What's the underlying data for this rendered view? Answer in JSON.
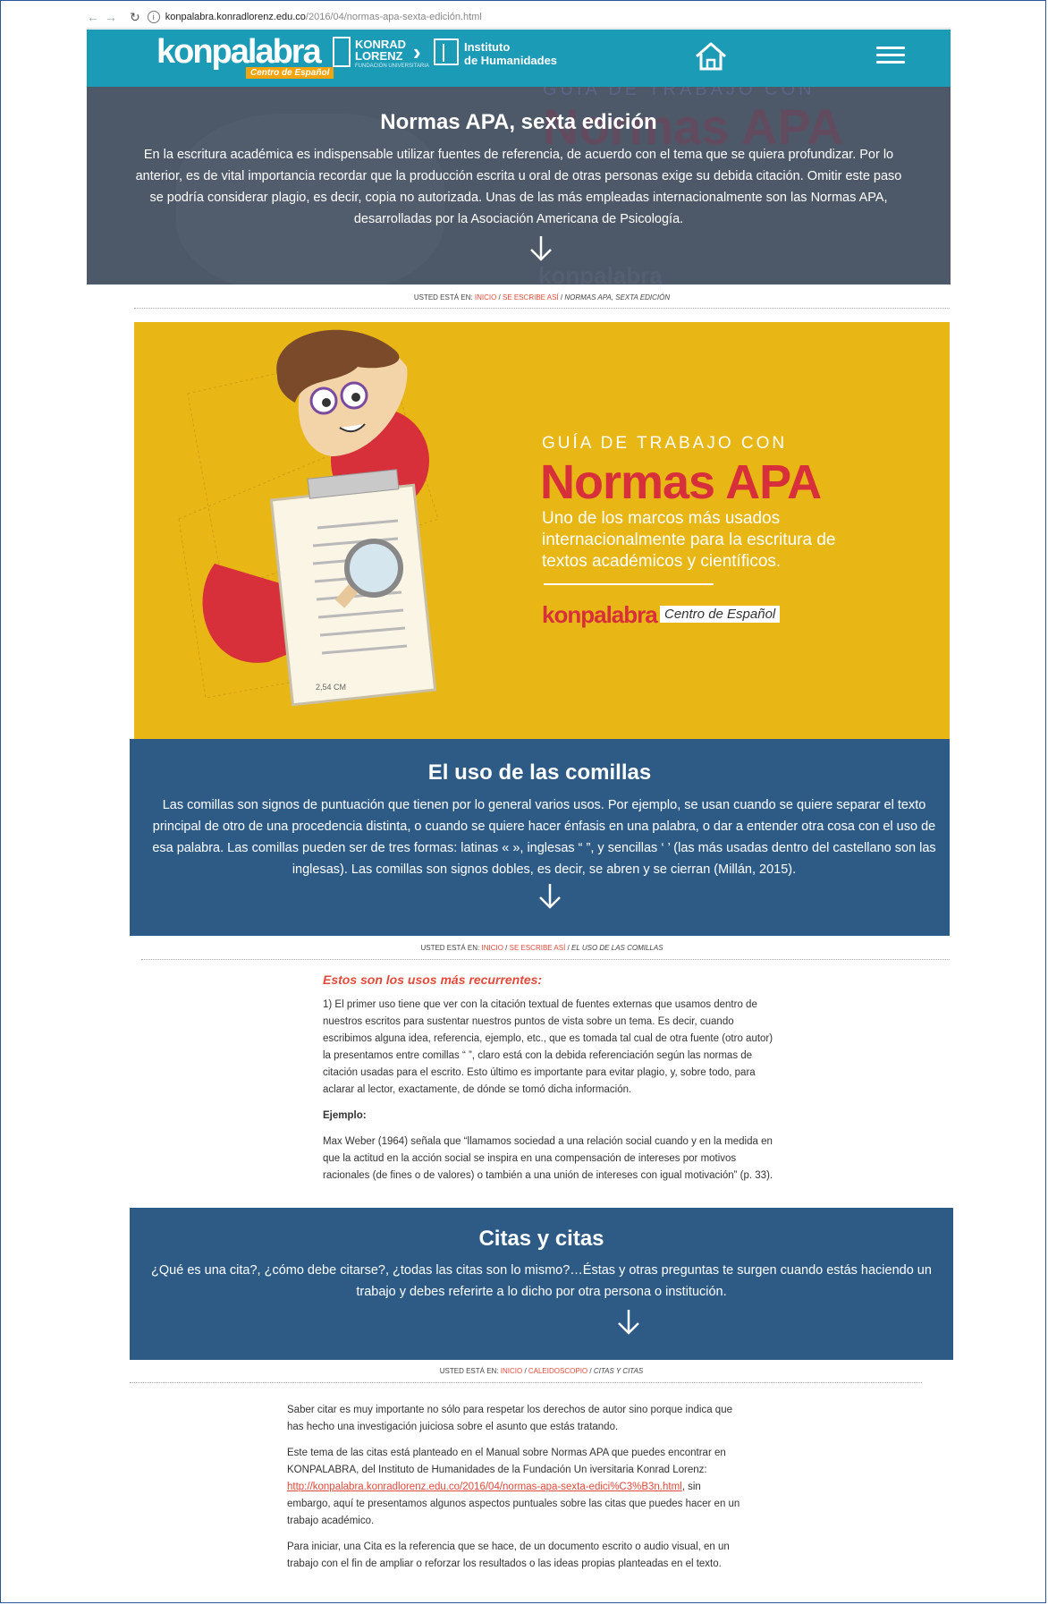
{
  "browser": {
    "url_host": "konpalabra.konradlorenz.edu.co",
    "url_path": "/2016/04/normas-apa-sexta-edición.html"
  },
  "header": {
    "logo_main": "konpalabra",
    "logo_sub": "Centro de Español",
    "konrad_line1": "KONRAD",
    "konrad_line2": "LORENZ",
    "konrad_sub": "FUNDACIÓN UNIVERSITARIA",
    "instituto_line1": "Instituto",
    "instituto_line2": "de Humanidades",
    "colors": {
      "bar": "#1b9bb6"
    },
    "icons": [
      "home-icon",
      "hamburger-menu-icon"
    ]
  },
  "hero": {
    "title": "Normas APA, sexta edición",
    "text": "En la escritura académica es indispensable utilizar fuentes de referencia, de acuerdo con el tema que se quiera profundizar. Por lo anterior, es de vital importancia recordar que la producción escrita u oral de otras personas exige su debida citación. Omitir este paso se podría considerar plagio, es decir, copia no autorizada. Unas de las más empleadas internacionalmente son las Normas APA, desarrolladas por la Asociación Americana de Psicología."
  },
  "breadcrumb1": {
    "prefix": "USTED ESTÁ EN:",
    "item1": "INICIO",
    "item2": "SE ESCRIBE ASÍ",
    "current": "NORMAS APA, SEXTA EDICIÓN"
  },
  "banner": {
    "overline": "GUÍA DE TRABAJO CON",
    "title": "Normas APA",
    "subtitle": "Uno de los marcos más usados internacionalmente para la escritura de textos académicos y científicos.",
    "brand": "konpalabra",
    "brand_tag": "Centro de Español",
    "measure_label": "2,54 CM",
    "colors": {
      "background": "#e8b716",
      "accent": "#d8303a"
    }
  },
  "comillas": {
    "title": "El uso de las comillas",
    "text": "Las comillas son signos de puntuación que tienen por lo general varios usos. Por ejemplo, se usan cuando se quiere separar el texto principal de otro de una procedencia distinta, o cuando se quiere hacer énfasis en una palabra, o dar a entender otra cosa con el uso de esa palabra. Las comillas pueden ser de tres formas: latinas « », inglesas “ ”, y sencillas ‘ ’ (las más usadas dentro del castellano son las inglesas). Las comillas son signos dobles, es decir, se abren y se cierran (Millán, 2015)."
  },
  "breadcrumb2": {
    "prefix": "USTED ESTÁ EN:",
    "item1": "INICIO",
    "item2": "SE ESCRIBE ASÍ",
    "current": "EL USO DE LAS COMILLAS"
  },
  "usos": {
    "lead": "Estos son los usos más recurrentes:",
    "p1": "1) El primer uso tiene que ver con la citación textual de fuentes externas que usamos dentro de nuestros escritos para sustentar nuestros puntos de vista sobre un tema. Es decir, cuando escribimos alguna idea, referencia, ejemplo, etc., que es tomada tal cual de otra fuente (otro autor) la presentamos entre comillas “ ”, claro está con la debida referenciación según las normas de citación usadas para el escrito. Esto último es importante para evitar plagio, y, sobre todo, para aclarar al lector, exactamente, de dónde se tomó dicha información.",
    "example_label": "Ejemplo:",
    "example": "Max Weber (1964) señala que “llamamos sociedad a una relación social cuando y en la medida en que la actitud en la acción social se inspira en una compensación de intereses por motivos racionales (de fines o de valores) o también a una unión de intereses con igual motivación” (p. 33)."
  },
  "citas": {
    "title": "Citas y citas",
    "text": "¿Qué es una cita?, ¿cómo debe citarse?, ¿todas las citas son lo mismo?…Éstas y otras preguntas te surgen cuando estás haciendo un trabajo y debes referirte a lo dicho por otra persona o institución."
  },
  "breadcrumb3": {
    "prefix": "USTED ESTÁ EN:",
    "item1": "INICIO",
    "item2": "CALEIDOSCOPIO",
    "current": "CITAS Y CITAS"
  },
  "article": {
    "p1": "Saber citar es muy importante no sólo para respetar los derechos de autor sino porque indica que has hecho una investigación juiciosa sobre el asunto que estás tratando.",
    "p2_before": "Este tema de las citas está planteado en el Manual sobre Normas APA que puedes encontrar en KONPALABRA, del Instituto de Humanidades de la Fundación Un iversitaria Konrad Lorenz:",
    "p2_link": "http://konpalabra.konradlorenz.edu.co/2016/04/normas-apa-sexta-edici%C3%B3n.html",
    "p2_after": ", sin embargo, aquí te presentamos algunos aspectos puntuales sobre las citas que puedes hacer en un trabajo académico.",
    "p3": "Para iniciar, una Cita es la referencia que se hace, de un documento escrito o audio visual, en un trabajo con el fin de ampliar o reforzar los resultados o las ideas propias planteadas en el texto."
  }
}
